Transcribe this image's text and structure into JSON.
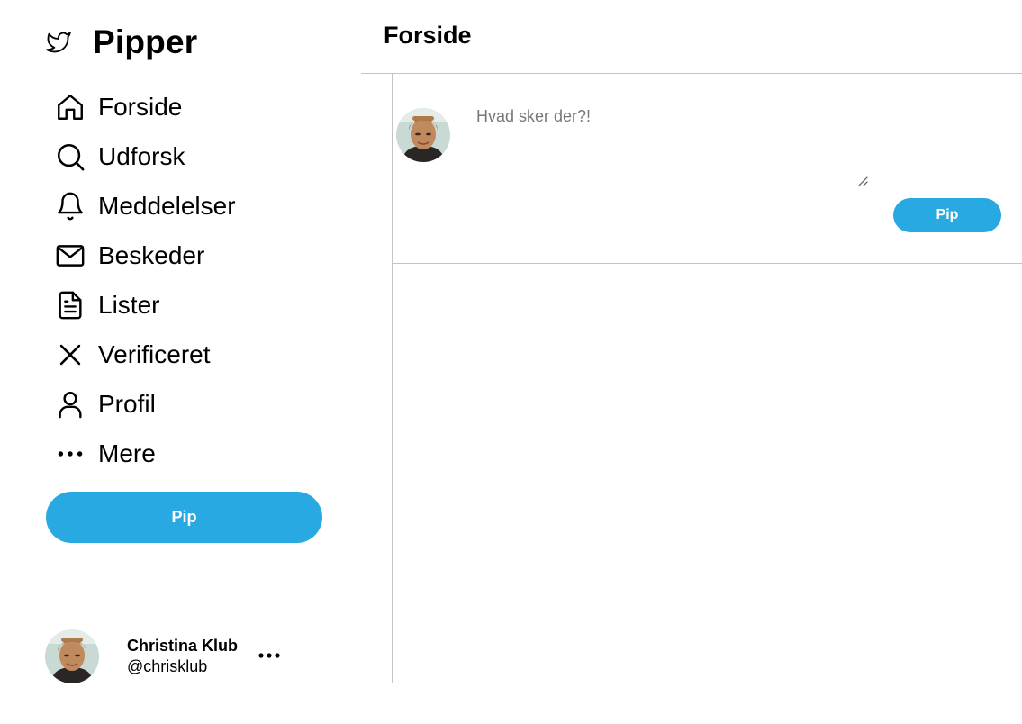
{
  "brand": {
    "name": "Pipper",
    "icon": "bird-icon"
  },
  "nav": {
    "items": [
      {
        "label": "Forside",
        "icon": "home-icon"
      },
      {
        "label": "Udforsk",
        "icon": "search-icon"
      },
      {
        "label": "Meddelelser",
        "icon": "bell-icon"
      },
      {
        "label": "Beskeder",
        "icon": "envelope-icon"
      },
      {
        "label": "Lister",
        "icon": "document-icon"
      },
      {
        "label": "Verificeret",
        "icon": "close-icon"
      },
      {
        "label": "Profil",
        "icon": "user-icon"
      },
      {
        "label": "Mere",
        "icon": "more-horizontal-icon"
      }
    ],
    "pip_label": "Pip"
  },
  "profile": {
    "name": "Christina Klub",
    "handle": "@chrisklub",
    "more_icon": "more-horizontal-icon"
  },
  "main": {
    "title": "Forside",
    "compose": {
      "placeholder": "Hvad sker der?!",
      "value": "",
      "submit_label": "Pip"
    }
  },
  "colors": {
    "accent": "#29a9e1",
    "divider": "#c4c4c4",
    "text": "#000000",
    "placeholder": "#777777"
  }
}
